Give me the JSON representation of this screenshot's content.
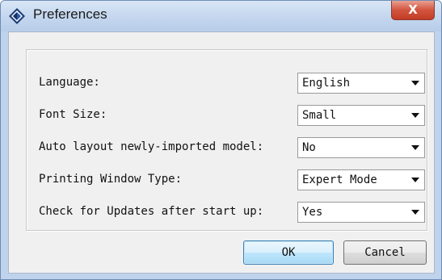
{
  "window": {
    "title": "Preferences",
    "close_glyph": "X",
    "icon": "app-diamond-icon"
  },
  "settings": [
    {
      "label": "Language:",
      "value": "English"
    },
    {
      "label": "Font Size:",
      "value": "Small"
    },
    {
      "label": "Auto layout newly-imported model:",
      "value": "No"
    },
    {
      "label": "Printing Window Type:",
      "value": "Expert Mode"
    },
    {
      "label": "Check for Updates after start up:",
      "value": "Yes"
    }
  ],
  "buttons": {
    "ok_label": "OK",
    "cancel_label": "Cancel"
  },
  "colors": {
    "titlebar": "#c2d5ee",
    "close_button": "#d2543e",
    "ok_button_border": "#3c7fb1"
  }
}
